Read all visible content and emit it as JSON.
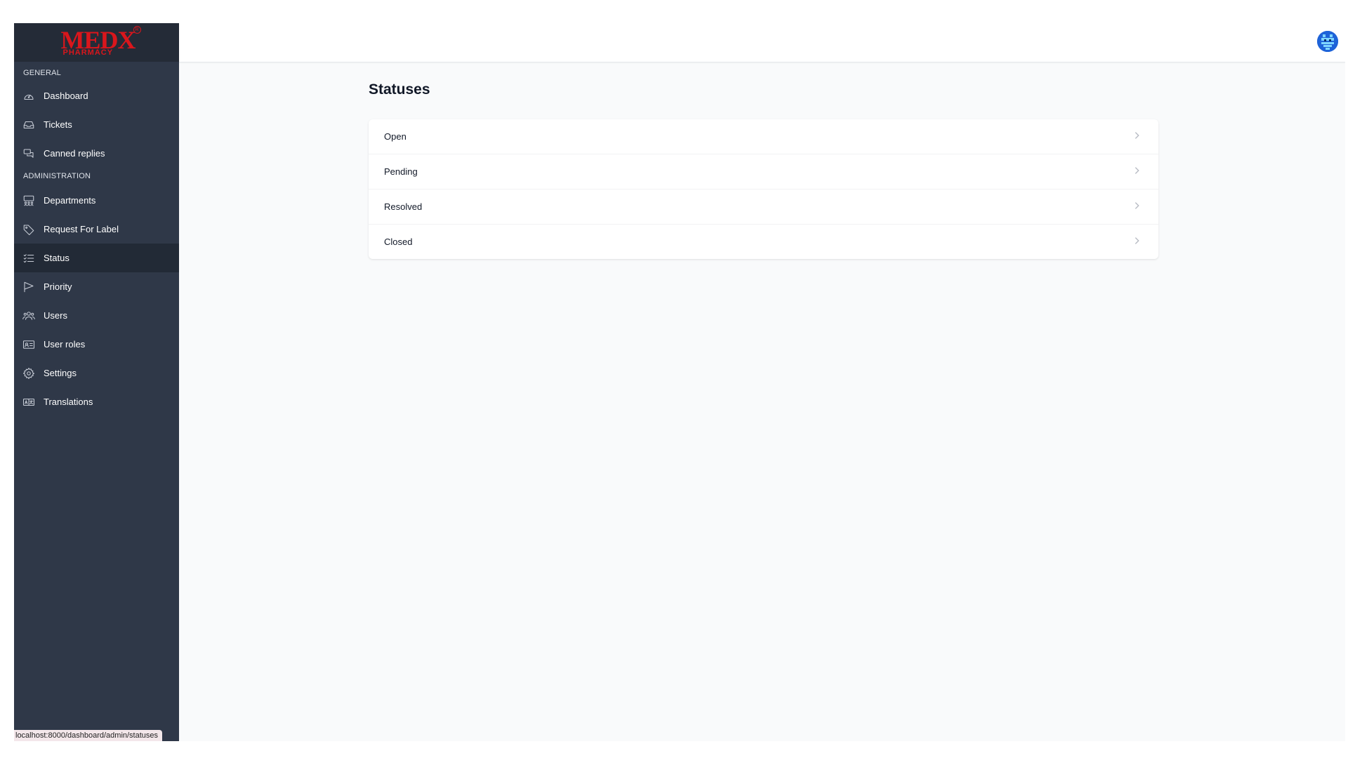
{
  "brand": {
    "logo_main": "MEDX",
    "logo_sub": "PHARMACY",
    "logo_mark": "R",
    "accent": "#d9161c"
  },
  "sidebar": {
    "sections": [
      {
        "label": "GENERAL"
      },
      {
        "label": "ADMINISTRATION"
      }
    ],
    "items": [
      {
        "label": "Dashboard",
        "icon": "dashboard-gauge-icon"
      },
      {
        "label": "Tickets",
        "icon": "inbox-icon"
      },
      {
        "label": "Canned replies",
        "icon": "chat-bubbles-icon"
      },
      {
        "label": "Departments",
        "icon": "departments-icon"
      },
      {
        "label": "Request For Label",
        "icon": "tag-icon"
      },
      {
        "label": "Status",
        "icon": "list-check-icon",
        "active": true
      },
      {
        "label": "Priority",
        "icon": "flag-icon"
      },
      {
        "label": "Users",
        "icon": "users-icon"
      },
      {
        "label": "User roles",
        "icon": "id-card-icon"
      },
      {
        "label": "Settings",
        "icon": "gear-icon"
      },
      {
        "label": "Translations",
        "icon": "translate-icon"
      }
    ],
    "colors": {
      "bg": "#2f3848",
      "active": "#222a36",
      "logo_bg": "#242b37"
    }
  },
  "topbar": {
    "avatar": "user-avatar-icon"
  },
  "main": {
    "title": "Statuses",
    "statuses": [
      {
        "label": "Open"
      },
      {
        "label": "Pending"
      },
      {
        "label": "Resolved"
      },
      {
        "label": "Closed"
      }
    ]
  },
  "status_bar": {
    "url": "localhost:8000/dashboard/admin/statuses"
  }
}
